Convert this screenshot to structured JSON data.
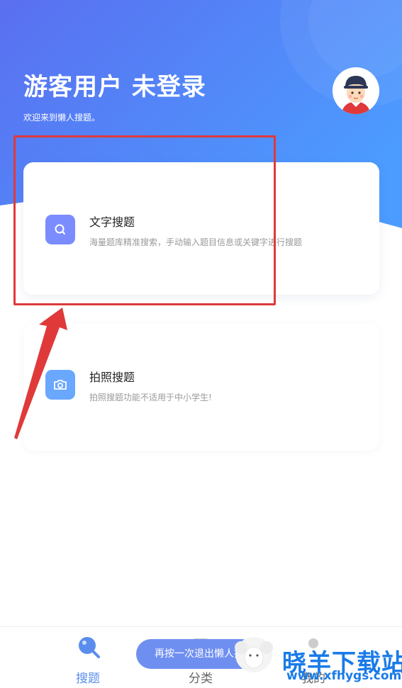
{
  "header": {
    "title": "游客用户 未登录",
    "subtitle": "欢迎来到懒人搜题。"
  },
  "cards": [
    {
      "title": "文字搜题",
      "desc": "海量题库精准搜索，手动输入题目信息或关键字进行搜题",
      "icon": "search-icon"
    },
    {
      "title": "拍照搜题",
      "desc": "拍照搜题功能不适用于中小学生!",
      "icon": "camera-icon"
    }
  ],
  "tabbar": {
    "items": [
      {
        "label": "搜题",
        "icon": "search-tab-icon",
        "active": true
      },
      {
        "label": "分类",
        "icon": "category-tab-icon",
        "active": false
      },
      {
        "label": "我的",
        "icon": "profile-tab-icon",
        "active": false
      }
    ]
  },
  "toast": {
    "text": "再按一次退出懒人搜题"
  },
  "watermark": {
    "text": "晓羊下载站",
    "url": "www.xfhygs.com"
  },
  "colors": {
    "brand_gradient_start": "#5a6ff0",
    "brand_gradient_end": "#4c9bff",
    "highlight": "#e0393a",
    "tab_active": "#5a8dee"
  }
}
